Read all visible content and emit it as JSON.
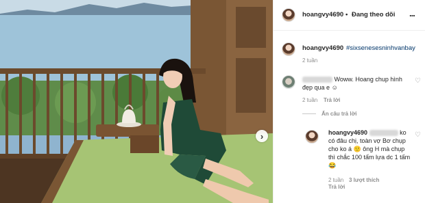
{
  "post": {
    "username": "hoangvy4690",
    "follow_separator": "•",
    "follow_label": "Đang theo dõi",
    "more_icon_text": "...",
    "caption_tag": "#sixsenesesninhvanbay",
    "caption_age": "2 tuần",
    "next_icon_text": "›"
  },
  "comments": [
    {
      "text": "Woww. Hoang chup hình đẹp qua e",
      "emoji": "☺",
      "age": "2 tuần",
      "reply_label": "Trả lời"
    }
  ],
  "hide_replies_label": "Ẩn câu trả lời",
  "reply": {
    "username": "hoangvy4690",
    "text": "ko có đâu chị, toàn vợ Bơ chụp cho ko á 🙂 ông H mà chụp thì chắc 100 tấm lựa dc 1 tấm",
    "emoji": "😂",
    "age": "2 tuần",
    "likes": "3 lượt thích",
    "reply_label": "Trả lời"
  },
  "icons": {
    "heart": "♡"
  },
  "colors": {
    "hashtag": "#003569",
    "muted": "#8e8e8e",
    "sea": "#9ec3d9",
    "cushion": "#9fbf6b",
    "dress": "#1f4a37",
    "wood": "#6a4a2e"
  }
}
